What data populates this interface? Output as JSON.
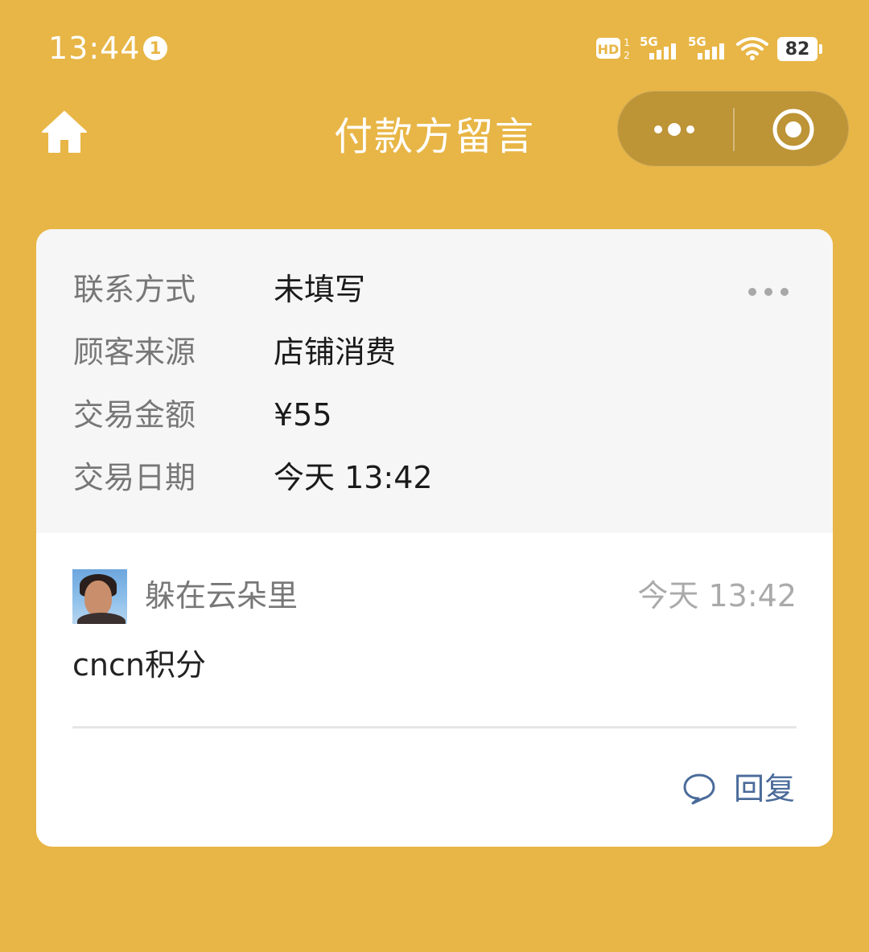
{
  "status_bar": {
    "time": "13:44",
    "notification_count": "1",
    "battery": "82",
    "icons": [
      "hd-voice-icon",
      "signal-5g-icon",
      "signal-5g-icon",
      "wifi-icon",
      "battery-icon"
    ]
  },
  "nav": {
    "title": "付款方留言",
    "home_icon": "home-icon",
    "more_icon": "more-dots-icon",
    "close_icon": "target-close-icon"
  },
  "info": {
    "rows": [
      {
        "label": "联系方式",
        "value": "未填写"
      },
      {
        "label": "顾客来源",
        "value": "店铺消费"
      },
      {
        "label": "交易金额",
        "value": "¥55"
      },
      {
        "label": "交易日期",
        "value": "今天 13:42"
      }
    ],
    "more_icon": "more-horizontal-icon"
  },
  "comment": {
    "user_name": "躲在云朵里",
    "time": "今天 13:42",
    "text": "cncn积分",
    "reply_label": "回复",
    "reply_icon": "chat-bubble-icon"
  },
  "colors": {
    "background": "#E8B646",
    "capsule": "#BD9436",
    "info_panel": "#F6F6F6",
    "reply_accent": "#4A6B9A"
  }
}
